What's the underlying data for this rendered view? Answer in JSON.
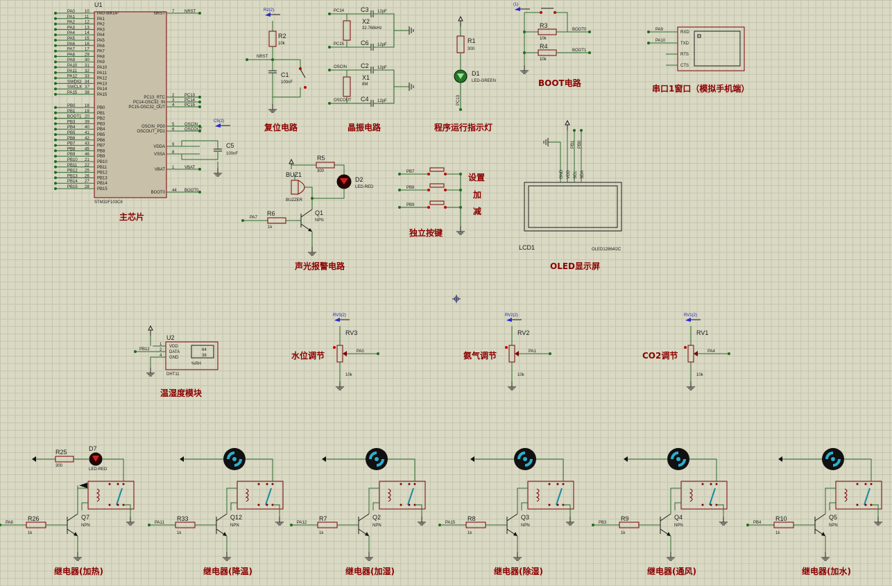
{
  "mcu": {
    "ref": "U1",
    "part": "STM32F103C8",
    "left_pins": [
      {
        "net": "PA0",
        "num": "10",
        "name": "PA0-WKUP"
      },
      {
        "net": "PA1",
        "num": "11",
        "name": "PA1"
      },
      {
        "net": "PA2",
        "num": "12",
        "name": "PA2"
      },
      {
        "net": "PA3",
        "num": "13",
        "name": "PA3"
      },
      {
        "net": "PA4",
        "num": "14",
        "name": "PA4"
      },
      {
        "net": "PA5",
        "num": "15",
        "name": "PA5"
      },
      {
        "net": "PA6",
        "num": "16",
        "name": "PA6"
      },
      {
        "net": "PA7",
        "num": "17",
        "name": "PA7"
      },
      {
        "net": "PA8",
        "num": "29",
        "name": "PA8"
      },
      {
        "net": "PA9",
        "num": "30",
        "name": "PA9"
      },
      {
        "net": "PA10",
        "num": "31",
        "name": "PA10"
      },
      {
        "net": "PA11",
        "num": "32",
        "name": "PA11"
      },
      {
        "net": "PA12",
        "num": "33",
        "name": "PA12"
      },
      {
        "net": "SWDIO",
        "num": "34",
        "name": "PA13"
      },
      {
        "net": "SWCLK",
        "num": "37",
        "name": "PA14"
      },
      {
        "net": "PA15",
        "num": "38",
        "name": "PA15"
      },
      {
        "net": "PB0",
        "num": "18",
        "name": "PB0"
      },
      {
        "net": "PB1",
        "num": "19",
        "name": "PB1"
      },
      {
        "net": "BOOT1",
        "num": "20",
        "name": "PB2"
      },
      {
        "net": "PB3",
        "num": "39",
        "name": "PB3"
      },
      {
        "net": "PB4",
        "num": "40",
        "name": "PB4"
      },
      {
        "net": "PB5",
        "num": "41",
        "name": "PB5"
      },
      {
        "net": "PB6",
        "num": "42",
        "name": "PB6"
      },
      {
        "net": "PB7",
        "num": "43",
        "name": "PB7"
      },
      {
        "net": "PB8",
        "num": "45",
        "name": "PB8"
      },
      {
        "net": "PB9",
        "num": "46",
        "name": "PB9"
      },
      {
        "net": "PB10",
        "num": "21",
        "name": "PB10"
      },
      {
        "net": "PB11",
        "num": "22",
        "name": "PB11"
      },
      {
        "net": "PB12",
        "num": "25",
        "name": "PB12"
      },
      {
        "net": "PB13",
        "num": "26",
        "name": "PB13"
      },
      {
        "net": "PB14",
        "num": "27",
        "name": "PB14"
      },
      {
        "net": "PB15",
        "num": "28",
        "name": "PB15"
      }
    ],
    "right_pins": [
      {
        "net": "NRST",
        "num": "7",
        "name": "NRST"
      },
      {
        "net": "PC13",
        "num": "2",
        "name": "PC13_RTC"
      },
      {
        "net": "PC14",
        "num": "3",
        "name": "PC14-OSC32_IN"
      },
      {
        "net": "PC15",
        "num": "4",
        "name": "PC15-OSC32_OUT"
      },
      {
        "net": "OSCIN",
        "num": "5",
        "name": "OSCIN_PD0"
      },
      {
        "net": "OSCOUT",
        "num": "6",
        "name": "OSCOUT_PD1"
      },
      {
        "net": "",
        "num": "9",
        "name": "VDDA"
      },
      {
        "net": "",
        "num": "8",
        "name": "VSSA"
      },
      {
        "net": "VBAT",
        "num": "1",
        "name": "VBAT"
      },
      {
        "net": "BOOT0",
        "num": "44",
        "name": "BOOT0"
      }
    ],
    "caption": "主芯片"
  },
  "c5": {
    "ref": "C5",
    "value": "100nF",
    "probe": "C5(2)"
  },
  "reset": {
    "probe": "R2(2)",
    "r_ref": "R2",
    "r_value": "10k",
    "net": "NRST",
    "c_ref": "C1",
    "c_value": "100nF",
    "caption": "复位电路"
  },
  "crystal": {
    "c3": "C3",
    "c3v": "12pF",
    "c6": "C6",
    "c6v": "12pF",
    "x2": "X2",
    "x2v": "32.768kHz",
    "c2": "C2",
    "c2v": "12pF",
    "c4": "C4",
    "c4v": "12pF",
    "x1": "X1",
    "x1v": "8M",
    "n1": "PC14",
    "n2": "PC15",
    "n3": "OSCIN",
    "n4": "OSCOUT",
    "caption": "晶振电路"
  },
  "led_run": {
    "r_ref": "R1",
    "r_value": "300",
    "d_ref": "D1",
    "d_value": "LED-GREEN",
    "net": "PC13",
    "caption": "程序运行指示灯"
  },
  "boot": {
    "probe": "(1)",
    "r3": "R3",
    "r3v": "10k",
    "r4": "R4",
    "r4v": "10k",
    "n0": "BOOT0",
    "n1": "BOOT1",
    "caption": "BOOT电路"
  },
  "uart": {
    "n1": "PA9",
    "n2": "PA10",
    "p1": "RXD",
    "p2": "TXD",
    "p3": "RTS",
    "p4": "CTS",
    "caption": "串口1窗口（模拟手机端）"
  },
  "alarm": {
    "buz": "BUZ1",
    "buzv": "BUZZER",
    "r5": "R5",
    "r5v": "300",
    "d2": "D2",
    "d2v": "LED-RED",
    "r6": "R6",
    "r6v": "1k",
    "q1": "Q1",
    "q1v": "NPN",
    "net": "PA7",
    "caption": "声光报警电路"
  },
  "keys": {
    "n1": "PB7",
    "n2": "PB8",
    "n3": "PB9",
    "l1": "设置",
    "l2": "加",
    "l3": "减",
    "caption": "独立按键"
  },
  "oled": {
    "ref": "LCD1",
    "part": "OLED12864I2C",
    "pins": [
      "GND",
      "VDD",
      "SCL",
      "SDA"
    ],
    "nets": [
      "PB1",
      "PB0"
    ],
    "caption": "OLED显示屏"
  },
  "dht": {
    "ref": "U2",
    "part": "DHT11",
    "net": "PB12",
    "pins": [
      "VDD",
      "DATA",
      "GND"
    ],
    "nums": [
      "1",
      "2",
      "4"
    ],
    "lcd1": "64",
    "lcd2": "38",
    "lcd3": "%RH",
    "caption": "温湿度模块"
  },
  "pots": [
    {
      "probe": "RV3(2)",
      "ref": "RV3",
      "value": "10k",
      "net": "PA0",
      "caption": "水位调节"
    },
    {
      "probe": "RV2(2)",
      "ref": "RV2",
      "value": "10k",
      "net": "PA1",
      "caption": "氨气调节"
    },
    {
      "probe": "RV1(2)",
      "ref": "RV1",
      "value": "10k",
      "net": "PA4",
      "caption": "CO2调节"
    }
  ],
  "relays": [
    {
      "net": "PA8",
      "r": "R26",
      "rv": "1k",
      "q": "Q7",
      "qv": "NPN",
      "caption": "继电器(加热)",
      "load": "led",
      "lr": "R25",
      "lrv": "300",
      "ld": "D7",
      "ldv": "LED-RED"
    },
    {
      "net": "PA11",
      "r": "R33",
      "rv": "1k",
      "q": "Q12",
      "qv": "NPN",
      "caption": "继电器(降温)",
      "load": "fan"
    },
    {
      "net": "PA12",
      "r": "R7",
      "rv": "1k",
      "q": "Q2",
      "qv": "NPN",
      "caption": "继电器(加湿)",
      "load": "fan"
    },
    {
      "net": "PA15",
      "r": "R8",
      "rv": "1k",
      "q": "Q3",
      "qv": "NPN",
      "caption": "继电器(除湿)",
      "load": "fan"
    },
    {
      "net": "PB3",
      "r": "R9",
      "rv": "1k",
      "q": "Q4",
      "qv": "NPN",
      "caption": "继电器(通风)",
      "load": "fan"
    },
    {
      "net": "PB4",
      "r": "R10",
      "rv": "1k",
      "q": "Q5",
      "qv": "NPN",
      "caption": "继电器(加水)",
      "load": "fan"
    }
  ]
}
